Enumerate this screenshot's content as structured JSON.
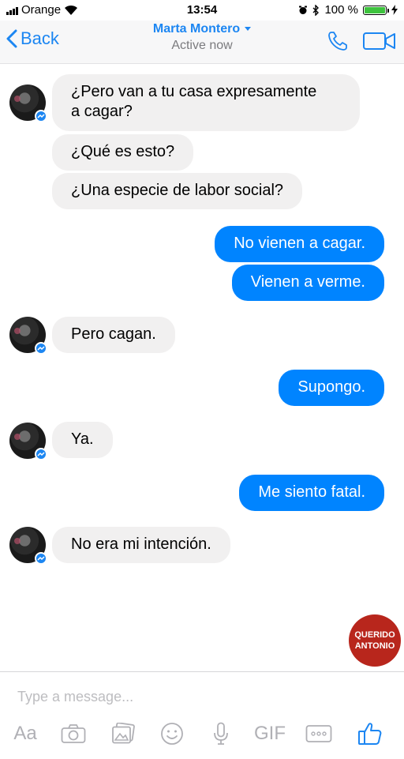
{
  "status_bar": {
    "carrier": "Orange",
    "time": "13:54",
    "battery_percent": "100 %",
    "battery_level": 1.0,
    "icons": [
      "signal-bars-icon",
      "wifi-icon",
      "alarm-icon",
      "bluetooth-icon",
      "battery-icon",
      "charging-bolt-icon"
    ]
  },
  "header": {
    "back_label": "Back",
    "contact_name": "Marta Montero",
    "status": "Active now",
    "icons": [
      "back-chevron-icon",
      "name-caret-icon",
      "phone-call-icon",
      "video-call-icon"
    ]
  },
  "messages": [
    {
      "from": "them",
      "lines": [
        "¿Pero van a tu casa expresamente",
        "a cagar?"
      ]
    },
    {
      "from": "them",
      "text": "¿Qué es esto?"
    },
    {
      "from": "them",
      "text": "¿Una especie de labor social?"
    },
    {
      "from": "me",
      "text": "No vienen a cagar."
    },
    {
      "from": "me",
      "text": "Vienen a verme."
    },
    {
      "from": "them",
      "text": "Pero cagan."
    },
    {
      "from": "me",
      "text": "Supongo."
    },
    {
      "from": "them",
      "text": "Ya."
    },
    {
      "from": "me",
      "text": "Me siento fatal."
    },
    {
      "from": "them",
      "text": "No era mi intención."
    }
  ],
  "watermark": {
    "line1": "QUERIDO",
    "line2": "ANTONIO"
  },
  "composer": {
    "placeholder": "Type a message...",
    "aa_label": "Aa",
    "gif_label": "GIF",
    "icons": [
      "camera-icon",
      "gallery-icon",
      "emoji-icon",
      "microphone-icon",
      "more-icon",
      "thumbs-up-icon"
    ]
  },
  "colors": {
    "accent": "#1c86f2",
    "outgoing_bubble": "#0084ff",
    "incoming_bubble": "#f1f0f0",
    "watermark_bg": "#b8261c",
    "battery_fill": "#3ec33e"
  }
}
